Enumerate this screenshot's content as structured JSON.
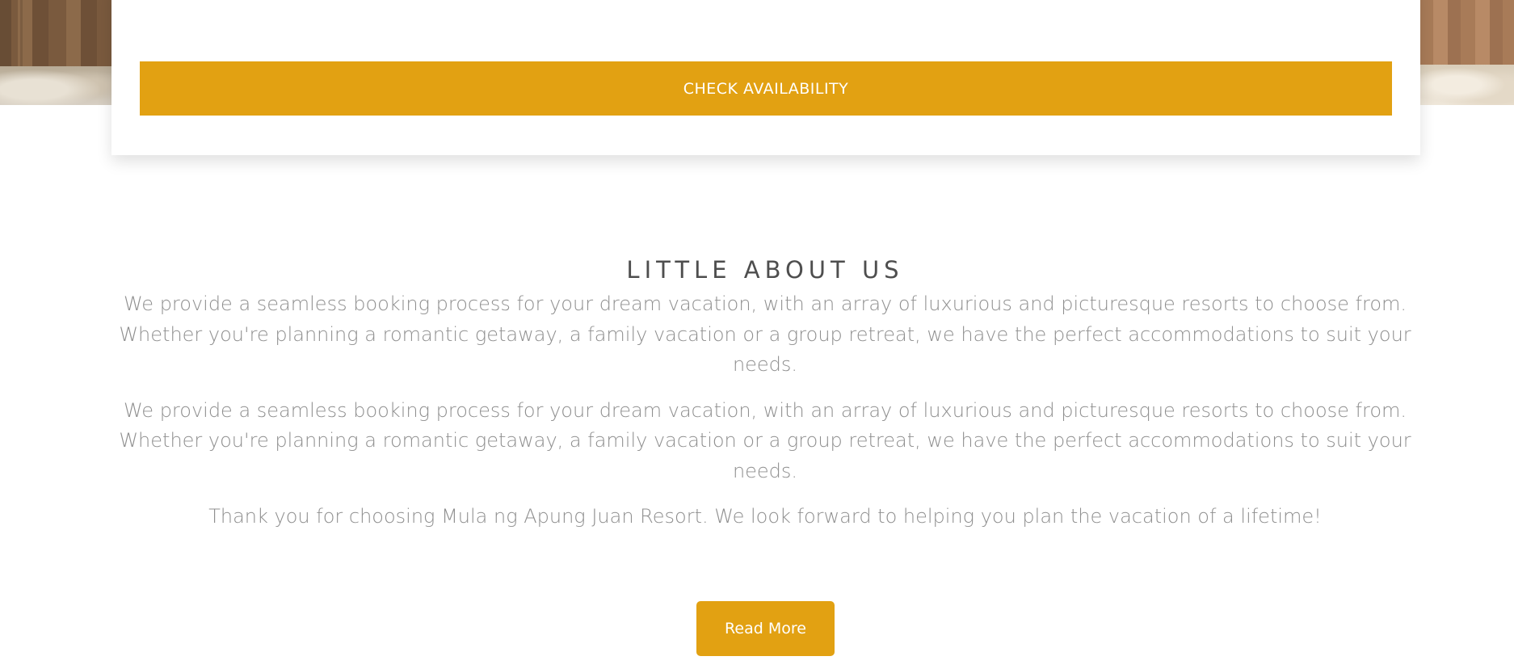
{
  "booking": {
    "check_availability_label": "CHECK AVAILABILITY"
  },
  "about": {
    "title": "LITTLE ABOUT US",
    "paragraphs": [
      "We provide a seamless booking process for your dream vacation, with an array of luxurious and picturesque resorts to choose from. Whether you're planning a romantic getaway, a family vacation or a group retreat, we have the perfect accommodations to suit your needs.",
      "We provide a seamless booking process for your dream vacation, with an array of luxurious and picturesque resorts to choose from. Whether you're planning a romantic getaway, a family vacation or a group retreat, we have the perfect accommodations to suit your needs.",
      "Thank you for choosing Mula ng Apung Juan Resort. We look forward to helping you plan the vacation of a lifetime!"
    ],
    "read_more_label": "Read More"
  },
  "colors": {
    "accent": "#e2a112",
    "title_text": "#4e4e4e",
    "body_text": "#8f8f8f",
    "background": "#ffffff"
  }
}
